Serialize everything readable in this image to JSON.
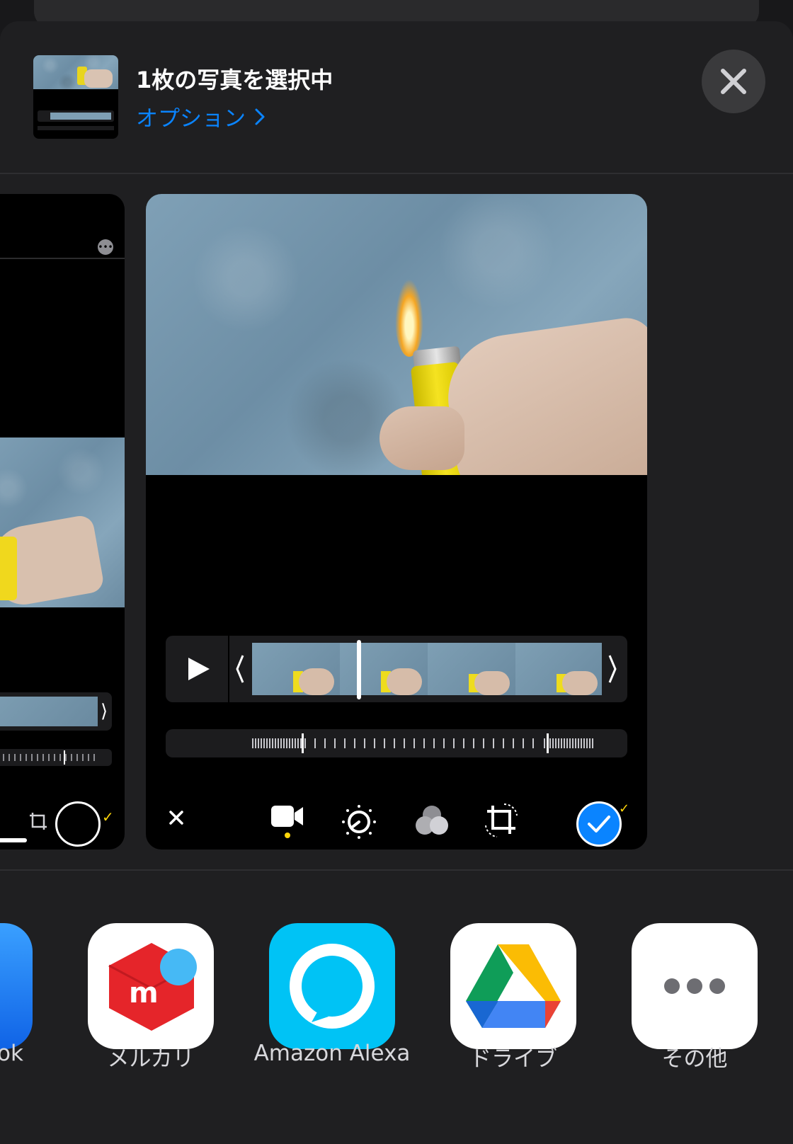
{
  "header": {
    "title": "1枚の写真を選択中",
    "options_label": "オプション"
  },
  "apps": [
    {
      "label": "ok",
      "icon": "partial-blue-app-icon"
    },
    {
      "label": "メルカリ",
      "icon": "mercari-icon"
    },
    {
      "label": "Amazon Alexa",
      "icon": "alexa-icon"
    },
    {
      "label": "ドライブ",
      "icon": "google-drive-icon"
    },
    {
      "label": "その他",
      "icon": "more-icon"
    }
  ],
  "colors": {
    "accent": "#0a84ff",
    "sheet": "#1f1f21",
    "alexa": "#00c3f5",
    "mercari": "#e5252a",
    "edit_yellow": "#ffd60a"
  }
}
